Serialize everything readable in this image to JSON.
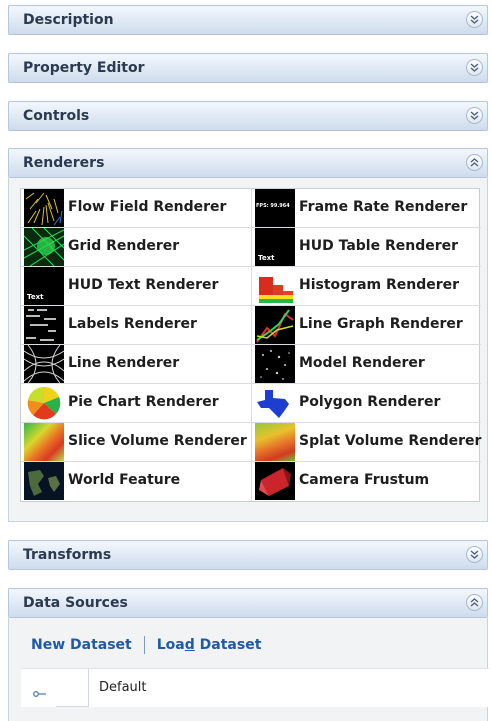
{
  "panels": {
    "description": "Description",
    "property_editor": "Property Editor",
    "controls": "Controls",
    "renderers": "Renderers",
    "transforms": "Transforms",
    "data_sources": "Data Sources"
  },
  "renderers": [
    [
      "Flow Field Renderer",
      "Frame Rate Renderer"
    ],
    [
      "Grid Renderer",
      "HUD Table Renderer"
    ],
    [
      "HUD Text Renderer",
      "Histogram Renderer"
    ],
    [
      "Labels Renderer",
      "Line Graph Renderer"
    ],
    [
      "Line Renderer",
      "Model Renderer"
    ],
    [
      "Pie Chart Renderer",
      "Polygon Renderer"
    ],
    [
      "Slice Volume Renderer",
      "Splat Volume Renderer"
    ],
    [
      "World Feature",
      "Camera Frustum"
    ]
  ],
  "thumb_text": {
    "fps": "FPS: 99.964",
    "hud_table": "Text",
    "hud_text": "Text"
  },
  "data_sources": {
    "new_dataset": "New Dataset",
    "load_prefix": "Loa",
    "load_underline": "d",
    "load_suffix": " Dataset",
    "dataset_name": "Default"
  },
  "colors": {
    "link": "#1f5aa8",
    "header_text": "#2b3a4e",
    "accent_line": "#5b7fc0"
  }
}
